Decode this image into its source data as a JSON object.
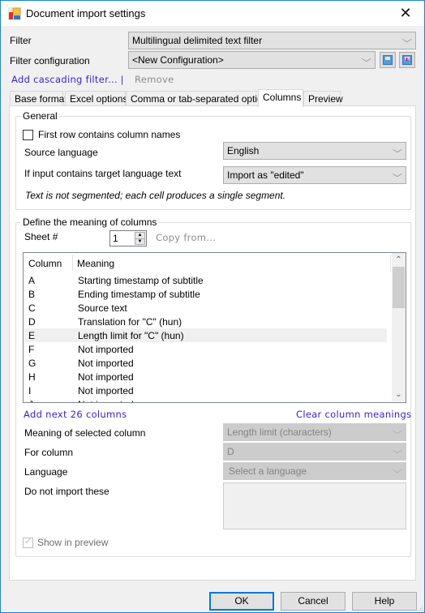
{
  "window": {
    "title": "Document import settings",
    "close_glyph": "✕"
  },
  "filter": {
    "label": "Filter",
    "value": "Multilingual delimited text filter"
  },
  "filter_configuration": {
    "label": "Filter configuration",
    "value": "<New Configuration>"
  },
  "links": {
    "add_cascading_filter": "Add cascading filter...",
    "separator": "|",
    "remove": "Remove"
  },
  "tabs": [
    {
      "label": "Base format"
    },
    {
      "label": "Excel options"
    },
    {
      "label": "Comma or tab-separated options"
    },
    {
      "label": "Columns",
      "active": true
    },
    {
      "label": "Preview"
    }
  ],
  "general": {
    "title": "General",
    "first_row_label": "First row contains column names",
    "first_row_checked": false,
    "source_language_label": "Source language",
    "source_language_value": "English",
    "target_text_label": "If input contains target language text",
    "target_text_value": "Import as \"edited\"",
    "note": "Text is not segmented; each cell produces a single segment."
  },
  "define_columns": {
    "title": "Define the meaning of columns",
    "sheet_label": "Sheet #",
    "sheet_value": "1",
    "copy_from": "Copy from...",
    "list": {
      "headers": [
        "Column",
        "Meaning"
      ],
      "rows": [
        {
          "column": "A",
          "meaning": "Starting timestamp of subtitle"
        },
        {
          "column": "B",
          "meaning": "Ending timestamp of subtitle"
        },
        {
          "column": "C",
          "meaning": "Source text"
        },
        {
          "column": "D",
          "meaning": "Translation for \"C\" (hun)"
        },
        {
          "column": "E",
          "meaning": "Length limit for \"C\" (hun)",
          "selected": true
        },
        {
          "column": "F",
          "meaning": "Not imported"
        },
        {
          "column": "G",
          "meaning": "Not imported"
        },
        {
          "column": "H",
          "meaning": "Not imported"
        },
        {
          "column": "I",
          "meaning": "Not imported"
        },
        {
          "column": "J",
          "meaning": "Not imported"
        }
      ]
    },
    "add_next_columns": "Add next 26 columns",
    "clear_column_meanings": "Clear column meanings",
    "meaning_label": "Meaning of selected column",
    "meaning_value": "Length limit (characters)",
    "for_column_label": "For column",
    "for_column_value": "D",
    "language_label": "Language",
    "language_value": "Select a language",
    "do_not_import_label": "Do not import these",
    "do_not_import_value": "",
    "show_in_preview_label": "Show in preview",
    "show_in_preview_checked": true
  },
  "buttons": {
    "ok": "OK",
    "cancel": "Cancel",
    "help": "Help"
  }
}
